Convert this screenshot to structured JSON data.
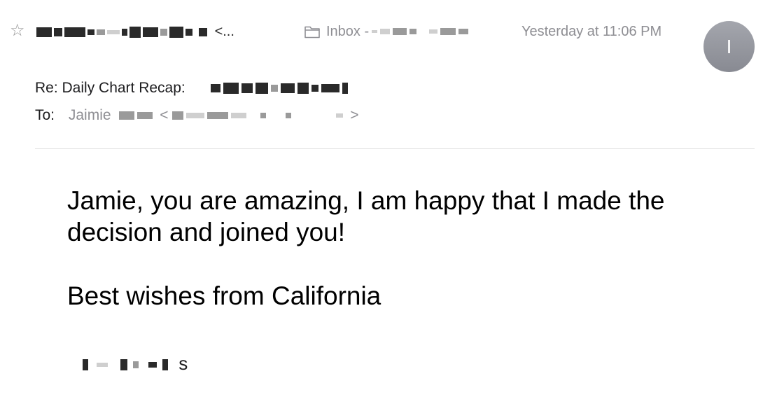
{
  "header": {
    "sender_tail": "<...",
    "mailbox_label": "Inbox -",
    "timestamp": "Yesterday at 11:06 PM",
    "avatar_initial": "I"
  },
  "message": {
    "subject_prefix": "Re: Daily Chart Recap:",
    "to_label": "To:",
    "recipient_visible": "Jaimie",
    "recipient_open": "<",
    "recipient_close": ">"
  },
  "body": {
    "paragraph_1": "Jamie, you are amazing, I am happy that I made the decision and joined you!",
    "paragraph_2": "Best wishes from California",
    "signature_tail": "s"
  },
  "icons": {
    "star": "star-icon",
    "folder": "folder-icon"
  },
  "colors": {
    "secondary_text": "#8e8e93",
    "avatar": "#9a9ca3",
    "divider": "#dedede"
  }
}
